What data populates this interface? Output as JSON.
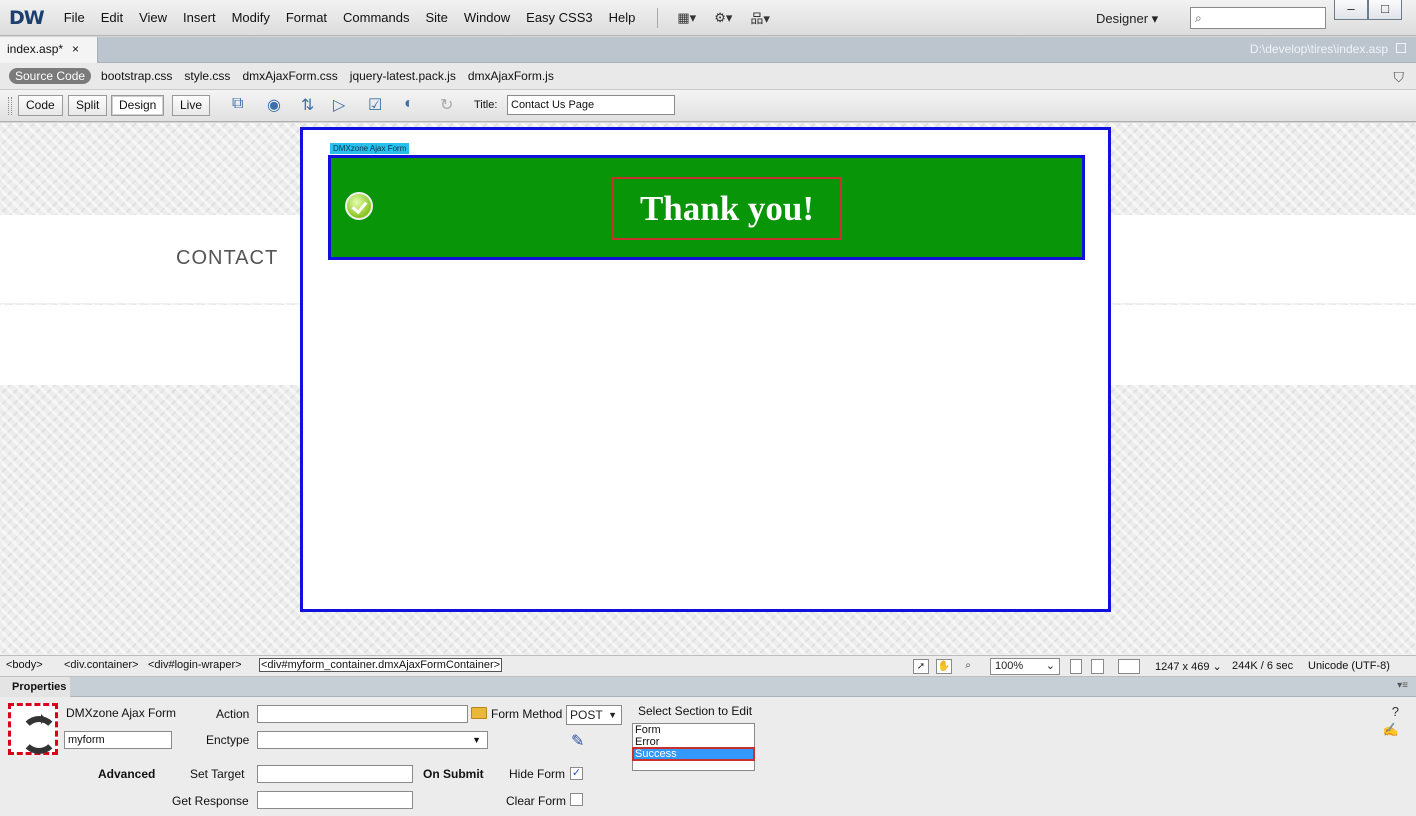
{
  "menubar": {
    "logo": "DW",
    "items": [
      "File",
      "Edit",
      "View",
      "Insert",
      "Modify",
      "Format",
      "Commands",
      "Site",
      "Window",
      "Easy CSS3",
      "Help"
    ],
    "icons": [
      "layout-icon",
      "gear-icon",
      "site-manager-icon"
    ],
    "workspace": "Designer",
    "search_placeholder": "",
    "window_buttons": [
      "minimize-icon",
      "maximize-icon"
    ]
  },
  "document": {
    "tab_label": "index.asp*",
    "tab_close": "×",
    "path": "D:\\develop\\tires\\index.asp"
  },
  "related_files": [
    "Source Code",
    "bootstrap.css",
    "style.css",
    "dmxAjaxForm.css",
    "jquery-latest.pack.js",
    "dmxAjaxForm.js"
  ],
  "doc_toolbar": {
    "views": [
      "Code",
      "Split",
      "Design",
      "Live"
    ],
    "active_view": "Design",
    "title_label": "Title:",
    "title_value": "Contact Us Page"
  },
  "canvas": {
    "contact_heading": "CONTACT",
    "form_tag": "DMXzone Ajax Form",
    "success_message": "Thank you!"
  },
  "statusbar": {
    "tags": [
      "<body>",
      "<div.container>",
      "<div#login-wraper>",
      "<div#myform_container.dmxAjaxFormContainer>"
    ],
    "zoom": "100%",
    "dimensions": "1247 x 469",
    "download": "244K / 6 sec",
    "encoding": "Unicode (UTF-8)"
  },
  "properties": {
    "panel_title": "Properties",
    "component_label": "DMXzone Ajax Form",
    "form_id": "myform",
    "action_label": "Action",
    "action_value": "",
    "enctype_label": "Enctype",
    "enctype_value": "",
    "form_method_label": "Form Method",
    "form_method_value": "POST",
    "section_label": "Select Section to Edit",
    "sections": [
      "Form",
      "Error",
      "Success"
    ],
    "selected_section": "Success",
    "advanced_label": "Advanced",
    "set_target_label": "Set Target",
    "set_target_value": "",
    "get_response_label": "Get Response",
    "get_response_value": "",
    "on_submit_label": "On Submit",
    "hide_form_label": "Hide Form",
    "hide_form_checked": true,
    "clear_form_label": "Clear Form",
    "clear_form_checked": false
  }
}
